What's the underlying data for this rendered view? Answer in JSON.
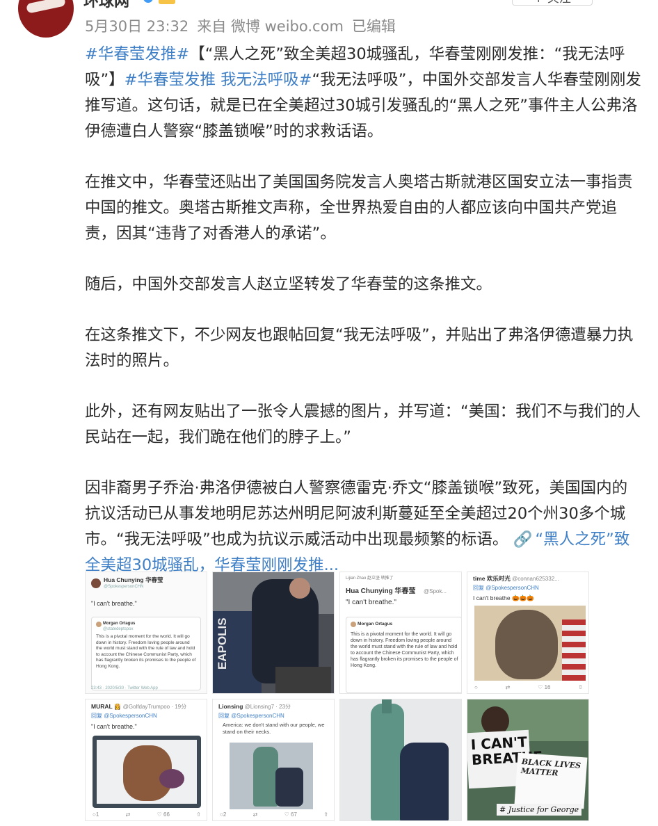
{
  "header": {
    "username": "环球网",
    "follow_label": "+ 关注",
    "time": "5月30日 23:32",
    "source": "来自 微博 weibo.com",
    "edited": "已编辑"
  },
  "post": {
    "p1": {
      "tag1": "#华春莹发推#",
      "text1": "【“黑人之死”致全美超30城骚乱，华春莹刚刚发推：“我无法呼吸”】",
      "tag2": "#华春莹发推 我无法呼吸#",
      "text2": "“我无法呼吸”，中国外交部发言人华春莹刚刚发推写道。这句话，就是已在全美超过30城引发骚乱的“黑人之死”事件主人公弗洛伊德遭白人警察“膝盖锁喉”时的求救话语。"
    },
    "p2": "在推文中，华春莹还贴出了美国国务院发言人奥塔古斯就港区国安立法一事指责中国的推文。奥塔古斯推文声称，全世界热爱自由的人都应该向中国共产党追责，因其“违背了对香港人的承诺”。",
    "p3": "随后，中国外交部发言人赵立坚转发了华春莹的这条推文。",
    "p4": "在这条推文下，不少网友也跟帖回复“我无法呼吸”，并贴出了弗洛伊德遭暴力执法时的照片。",
    "p5": "此外，还有网友贴出了一张令人震撼的图片，并写道：“美国：我们不与我们的人民站在一起，我们跪在他们的脖子上。”",
    "p6": {
      "text": "因非裔男子乔治·弗洛伊德被白人警察德雷克·乔文“膝盖锁喉”致死，美国国内的抗议活动已从事发地明尼苏达州明尼阿波利斯蔓延至全美超过20个州30多个城市。“我无法呼吸”也成为抗议示威活动中出现最频繁的标语。",
      "link_icon": "🔗",
      "link": "“黑人之死”致全美超30城骚乱，华春莹刚刚发推..."
    }
  },
  "images": {
    "img1": {
      "name": "Hua Chunying 华春莹",
      "handle": "@SpokespersonCHN",
      "quote": "\"I can't breathe.\"",
      "inner_name": "Morgan Ortagus",
      "inner_handle": "@statedeptspox",
      "body": "This is a pivotal moment for the world. It will go down in history. Freedom loving people around the world must stand with the rule of law and hold to account the Chinese Communist Party, which has flagrantly broken its promises to the people of Hong Kong.",
      "footer": "23:43 · 2020/5/30 · Twitter Web App"
    },
    "img2": {
      "label": "EAPOLIS"
    },
    "img3": {
      "retweet": "Lijian Zhao 赵立坚 转推了",
      "name": "Hua Chunying 华春莹",
      "handle": "@Spok...",
      "quote": "\"I can't breathe.\"",
      "inner_name": "Morgan Ortagus",
      "body": "This is a pivotal moment for the world. It will go down in history. Freedom loving people around the world must stand with the rule of law and hold to account the Chinese Communist Party, which has flagrantly broken its promises to the people of Hong Kong."
    },
    "img4": {
      "name": "time 欢乐时光",
      "handle": "@connan625332...",
      "reply": "回复 @SpokespersonCHN",
      "quote": "I can't breathe 🎃🎃🎃",
      "likes": "16"
    },
    "img5": {
      "name": "MURAL 👸",
      "handle": "@GolfdayTrumpoo · 19分",
      "reply": "回复 @SpokespersonCHN",
      "quote": "\"I can't breathe.\"",
      "likes": "66"
    },
    "img6": {
      "name": "Lionsing",
      "handle": "@Lionsing7 · 23分",
      "reply": "回复 @SpokespersonCHN",
      "body": "America: we don't stand with our people, we stand on their necks.",
      "likes": "67"
    },
    "img8": {
      "sign1": "I CAN'T",
      "sign2": "BREATHE",
      "sign3": "BLACK LIVES MATTER",
      "sign4": "# Justice for George"
    }
  }
}
